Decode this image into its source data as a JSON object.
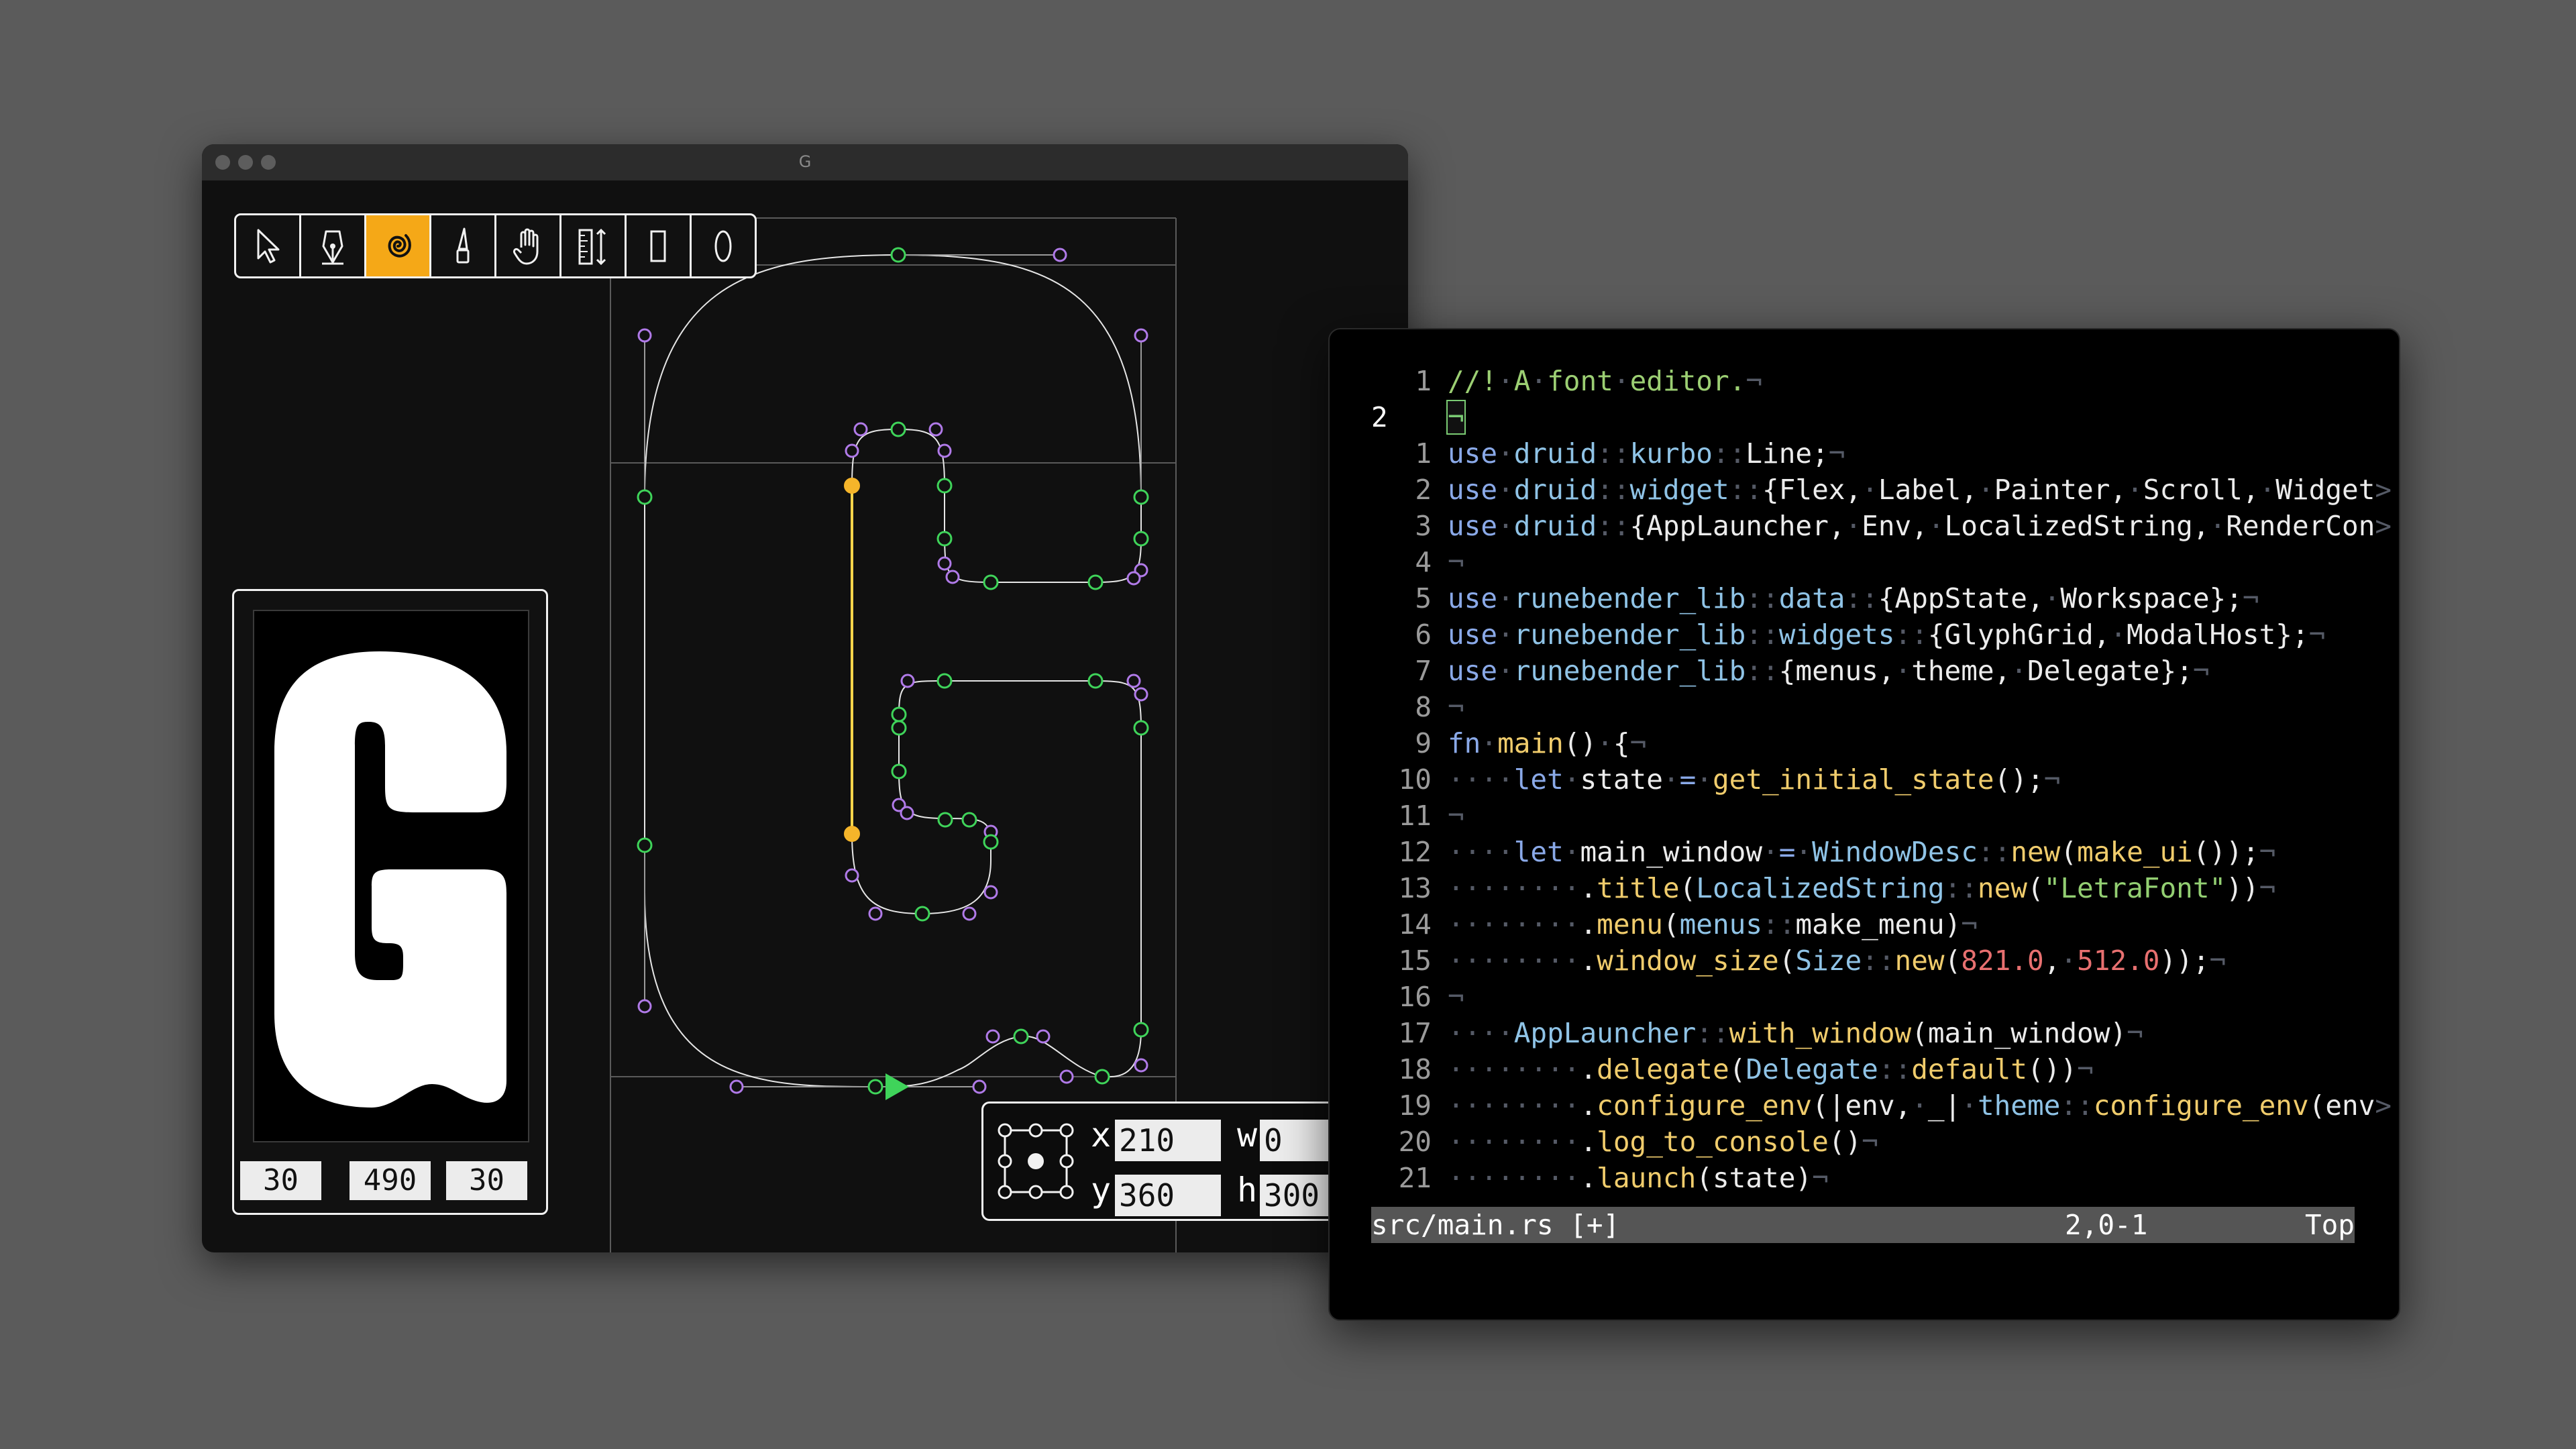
{
  "font_editor": {
    "window_title": "G",
    "toolbar": {
      "tools": [
        {
          "name": "select",
          "icon": "arrow-pointer-icon",
          "active": false
        },
        {
          "name": "pen",
          "icon": "pen-nib-icon",
          "active": false
        },
        {
          "name": "spiral",
          "icon": "spiral-icon",
          "active": true
        },
        {
          "name": "knife",
          "icon": "knife-icon",
          "active": false
        },
        {
          "name": "hand",
          "icon": "hand-icon",
          "active": false
        },
        {
          "name": "measure",
          "icon": "ruler-icon",
          "active": false
        },
        {
          "name": "rectangle",
          "icon": "rectangle-icon",
          "active": false
        },
        {
          "name": "ellipse",
          "icon": "ellipse-icon",
          "active": false
        }
      ],
      "active_color": "#f5a817"
    },
    "preview": {
      "glyph": "G",
      "left_bearing": "30",
      "advance_width": "490",
      "right_bearing": "30"
    },
    "coordinates": {
      "x_label": "x",
      "x_value": "210",
      "y_label": "y",
      "y_value": "360",
      "w_label": "w",
      "w_value": "0",
      "h_label": "h",
      "h_value": "300"
    },
    "colors": {
      "on_curve_point": "#3fd45a",
      "off_curve_point": "#b07ae8",
      "selected_point": "#f5b52a"
    }
  },
  "vim": {
    "current_line": "2",
    "lines": [
      {
        "num": "1",
        "segments": [
          [
            "c-com",
            "//!"
          ],
          [
            "c-ws",
            "·"
          ],
          [
            "c-com",
            "A"
          ],
          [
            "c-ws",
            "·"
          ],
          [
            "c-com",
            "font"
          ],
          [
            "c-ws",
            "·"
          ],
          [
            "c-com",
            "editor."
          ],
          [
            "c-ws",
            "¬"
          ]
        ]
      },
      {
        "num": "2",
        "current": true,
        "segments": [
          [
            "cursor",
            "¬"
          ]
        ]
      },
      {
        "num": "1",
        "segments": [
          [
            "c-kw",
            "use"
          ],
          [
            "c-ws",
            "·"
          ],
          [
            "c-ty",
            "druid"
          ],
          [
            "c-ws",
            "::"
          ],
          [
            "c-ty",
            "kurbo"
          ],
          [
            "c-ws",
            "::"
          ],
          [
            "c-punc",
            "Line;"
          ],
          [
            "c-ws",
            "¬"
          ]
        ]
      },
      {
        "num": "2",
        "segments": [
          [
            "c-kw",
            "use"
          ],
          [
            "c-ws",
            "·"
          ],
          [
            "c-ty",
            "druid"
          ],
          [
            "c-ws",
            "::"
          ],
          [
            "c-ty",
            "widget"
          ],
          [
            "c-ws",
            "::"
          ],
          [
            "c-punc",
            "{Flex,"
          ],
          [
            "c-ws",
            "·"
          ],
          [
            "c-punc",
            "Label,"
          ],
          [
            "c-ws",
            "·"
          ],
          [
            "c-punc",
            "Painter,"
          ],
          [
            "c-ws",
            "·"
          ],
          [
            "c-punc",
            "Scroll,"
          ],
          [
            "c-ws",
            "·"
          ],
          [
            "c-punc",
            "Widget"
          ],
          [
            "c-ws",
            ">"
          ]
        ]
      },
      {
        "num": "3",
        "segments": [
          [
            "c-kw",
            "use"
          ],
          [
            "c-ws",
            "·"
          ],
          [
            "c-ty",
            "druid"
          ],
          [
            "c-ws",
            "::"
          ],
          [
            "c-punc",
            "{AppLauncher,"
          ],
          [
            "c-ws",
            "·"
          ],
          [
            "c-punc",
            "Env,"
          ],
          [
            "c-ws",
            "·"
          ],
          [
            "c-punc",
            "LocalizedString,"
          ],
          [
            "c-ws",
            "·"
          ],
          [
            "c-punc",
            "RenderCon"
          ],
          [
            "c-ws",
            ">"
          ]
        ]
      },
      {
        "num": "4",
        "segments": [
          [
            "c-ws",
            "¬"
          ]
        ]
      },
      {
        "num": "5",
        "segments": [
          [
            "c-kw",
            "use"
          ],
          [
            "c-ws",
            "·"
          ],
          [
            "c-ty",
            "runebender_lib"
          ],
          [
            "c-ws",
            "::"
          ],
          [
            "c-ty",
            "data"
          ],
          [
            "c-ws",
            "::"
          ],
          [
            "c-punc",
            "{AppState,"
          ],
          [
            "c-ws",
            "·"
          ],
          [
            "c-punc",
            "Workspace};"
          ],
          [
            "c-ws",
            "¬"
          ]
        ]
      },
      {
        "num": "6",
        "segments": [
          [
            "c-kw",
            "use"
          ],
          [
            "c-ws",
            "·"
          ],
          [
            "c-ty",
            "runebender_lib"
          ],
          [
            "c-ws",
            "::"
          ],
          [
            "c-ty",
            "widgets"
          ],
          [
            "c-ws",
            "::"
          ],
          [
            "c-punc",
            "{GlyphGrid,"
          ],
          [
            "c-ws",
            "·"
          ],
          [
            "c-punc",
            "ModalHost};"
          ],
          [
            "c-ws",
            "¬"
          ]
        ]
      },
      {
        "num": "7",
        "segments": [
          [
            "c-kw",
            "use"
          ],
          [
            "c-ws",
            "·"
          ],
          [
            "c-ty",
            "runebender_lib"
          ],
          [
            "c-ws",
            "::"
          ],
          [
            "c-punc",
            "{menus,"
          ],
          [
            "c-ws",
            "·"
          ],
          [
            "c-punc",
            "theme,"
          ],
          [
            "c-ws",
            "·"
          ],
          [
            "c-punc",
            "Delegate};"
          ],
          [
            "c-ws",
            "¬"
          ]
        ]
      },
      {
        "num": "8",
        "segments": [
          [
            "c-ws",
            "¬"
          ]
        ]
      },
      {
        "num": "9",
        "segments": [
          [
            "c-kw",
            "fn"
          ],
          [
            "c-ws",
            "·"
          ],
          [
            "c-fn",
            "main"
          ],
          [
            "c-punc",
            "()"
          ],
          [
            "c-ws",
            "·"
          ],
          [
            "c-punc",
            "{"
          ],
          [
            "c-ws",
            "¬"
          ]
        ]
      },
      {
        "num": "10",
        "segments": [
          [
            "c-ws",
            "····"
          ],
          [
            "c-kw",
            "let"
          ],
          [
            "c-ws",
            "·"
          ],
          [
            "c-punc",
            "state"
          ],
          [
            "c-ws",
            "·"
          ],
          [
            "c-kw",
            "="
          ],
          [
            "c-ws",
            "·"
          ],
          [
            "c-fn",
            "get_initial_state"
          ],
          [
            "c-punc",
            "();"
          ],
          [
            "c-ws",
            "¬"
          ]
        ]
      },
      {
        "num": "11",
        "segments": [
          [
            "c-ws",
            "¬"
          ]
        ]
      },
      {
        "num": "12",
        "segments": [
          [
            "c-ws",
            "····"
          ],
          [
            "c-kw",
            "let"
          ],
          [
            "c-ws",
            "·"
          ],
          [
            "c-punc",
            "main_window"
          ],
          [
            "c-ws",
            "·"
          ],
          [
            "c-kw",
            "="
          ],
          [
            "c-ws",
            "·"
          ],
          [
            "c-ty",
            "WindowDesc"
          ],
          [
            "c-ws",
            "::"
          ],
          [
            "c-fn",
            "new"
          ],
          [
            "c-punc",
            "("
          ],
          [
            "c-fn",
            "make_ui"
          ],
          [
            "c-punc",
            "());"
          ],
          [
            "c-ws",
            "¬"
          ]
        ]
      },
      {
        "num": "13",
        "segments": [
          [
            "c-ws",
            "········"
          ],
          [
            "c-punc",
            "."
          ],
          [
            "c-fn",
            "title"
          ],
          [
            "c-punc",
            "("
          ],
          [
            "c-ty",
            "LocalizedString"
          ],
          [
            "c-ws",
            "::"
          ],
          [
            "c-fn",
            "new"
          ],
          [
            "c-punc",
            "("
          ],
          [
            "c-str",
            "\"LetraFont\""
          ],
          [
            "c-punc",
            "))"
          ],
          [
            "c-ws",
            "¬"
          ]
        ]
      },
      {
        "num": "14",
        "segments": [
          [
            "c-ws",
            "········"
          ],
          [
            "c-punc",
            "."
          ],
          [
            "c-fn",
            "menu"
          ],
          [
            "c-punc",
            "("
          ],
          [
            "c-ty",
            "menus"
          ],
          [
            "c-ws",
            "::"
          ],
          [
            "c-punc",
            "make_menu)"
          ],
          [
            "c-ws",
            "¬"
          ]
        ]
      },
      {
        "num": "15",
        "segments": [
          [
            "c-ws",
            "········"
          ],
          [
            "c-punc",
            "."
          ],
          [
            "c-fn",
            "window_size"
          ],
          [
            "c-punc",
            "("
          ],
          [
            "c-ty",
            "Size"
          ],
          [
            "c-ws",
            "::"
          ],
          [
            "c-fn",
            "new"
          ],
          [
            "c-punc",
            "("
          ],
          [
            "c-num",
            "821.0"
          ],
          [
            "c-punc",
            ","
          ],
          [
            "c-ws",
            "·"
          ],
          [
            "c-num",
            "512.0"
          ],
          [
            "c-punc",
            "));"
          ],
          [
            "c-ws",
            "¬"
          ]
        ]
      },
      {
        "num": "16",
        "segments": [
          [
            "c-ws",
            "¬"
          ]
        ]
      },
      {
        "num": "17",
        "segments": [
          [
            "c-ws",
            "····"
          ],
          [
            "c-ty",
            "AppLauncher"
          ],
          [
            "c-ws",
            "::"
          ],
          [
            "c-fn",
            "with_window"
          ],
          [
            "c-punc",
            "(main_window)"
          ],
          [
            "c-ws",
            "¬"
          ]
        ]
      },
      {
        "num": "18",
        "segments": [
          [
            "c-ws",
            "········"
          ],
          [
            "c-punc",
            "."
          ],
          [
            "c-fn",
            "delegate"
          ],
          [
            "c-punc",
            "("
          ],
          [
            "c-ty",
            "Delegate"
          ],
          [
            "c-ws",
            "::"
          ],
          [
            "c-fn",
            "default"
          ],
          [
            "c-punc",
            "())"
          ],
          [
            "c-ws",
            "¬"
          ]
        ]
      },
      {
        "num": "19",
        "segments": [
          [
            "c-ws",
            "········"
          ],
          [
            "c-punc",
            "."
          ],
          [
            "c-fn",
            "configure_env"
          ],
          [
            "c-punc",
            "(|env,"
          ],
          [
            "c-ws",
            "·"
          ],
          [
            "c-punc",
            "_|"
          ],
          [
            "c-ws",
            "·"
          ],
          [
            "c-ty",
            "theme"
          ],
          [
            "c-ws",
            "::"
          ],
          [
            "c-fn",
            "configure_env"
          ],
          [
            "c-punc",
            "(env"
          ],
          [
            "c-ws",
            ">"
          ]
        ]
      },
      {
        "num": "20",
        "segments": [
          [
            "c-ws",
            "········"
          ],
          [
            "c-punc",
            "."
          ],
          [
            "c-fn",
            "log_to_console"
          ],
          [
            "c-punc",
            "()"
          ],
          [
            "c-ws",
            "¬"
          ]
        ]
      },
      {
        "num": "21",
        "segments": [
          [
            "c-ws",
            "········"
          ],
          [
            "c-punc",
            "."
          ],
          [
            "c-fn",
            "launch"
          ],
          [
            "c-punc",
            "(state)"
          ],
          [
            "c-ws",
            "¬"
          ]
        ]
      }
    ],
    "status": {
      "file": "src/main.rs [+]",
      "position": "2,0-1",
      "scroll": "Top"
    }
  }
}
